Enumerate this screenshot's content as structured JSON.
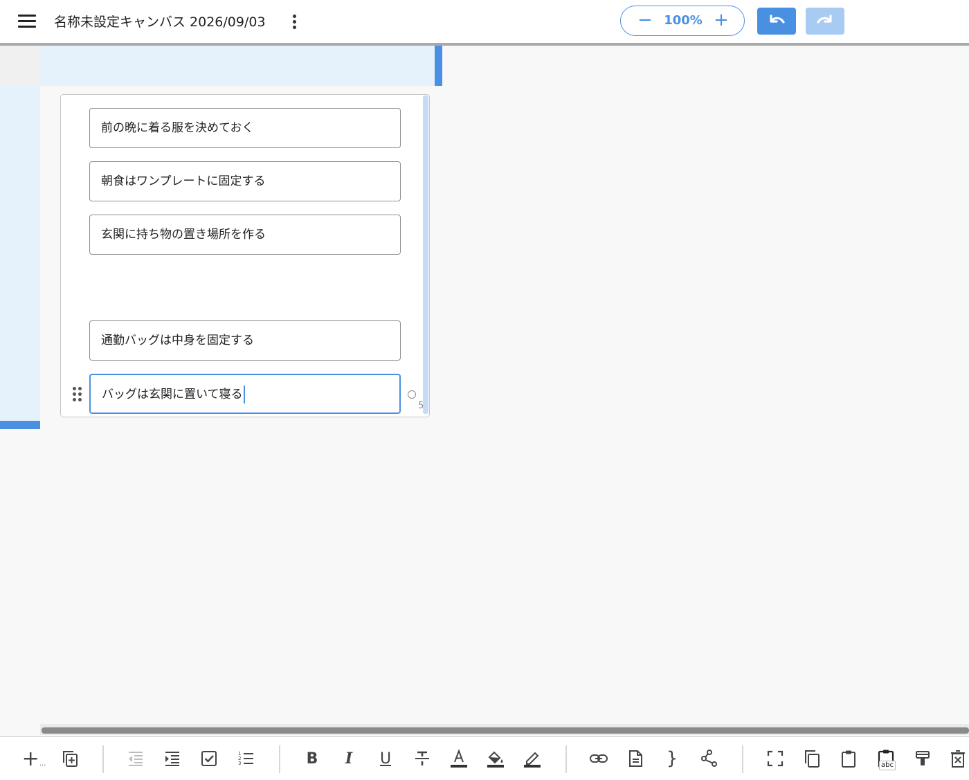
{
  "header": {
    "title": "名称未設定キャンバス 2026/09/03",
    "zoom": {
      "minus": "−",
      "value": "100%",
      "plus": "+"
    },
    "undo_enabled": true,
    "redo_enabled": false
  },
  "colors": {
    "accent": "#4a90e2",
    "accent_light": "#e5f1fb",
    "redo_disabled": "#a7cbf2"
  },
  "card": {
    "items": [
      "前の晩に着る服を決めておく",
      "朝食はワンプレートに固定する",
      "玄関に持ち物の置き場所を作る",
      "通勤バッグは中身を固定する"
    ],
    "active_item": "バッグは玄関に置いて寝る",
    "count": "5"
  },
  "toolbar": {
    "add_label": "+",
    "add_suffix": "...",
    "bold": "B",
    "italic": "I",
    "underline": "U",
    "font_color": "A",
    "code": "}",
    "paste_text_label": "abc",
    "icons": [
      "add-node-icon",
      "duplicate-icon",
      "outdent-icon",
      "indent-icon",
      "checkbox-icon",
      "numbered-list-icon",
      "bold-icon",
      "italic-icon",
      "underline-icon",
      "strikethrough-icon",
      "font-color-icon",
      "fill-color-icon",
      "border-color-icon",
      "link-icon",
      "document-icon",
      "code-brace-icon",
      "share-icon",
      "fullscreen-icon",
      "copy-icon",
      "paste-icon",
      "paste-text-icon",
      "format-painter-icon",
      "delete-icon"
    ]
  }
}
